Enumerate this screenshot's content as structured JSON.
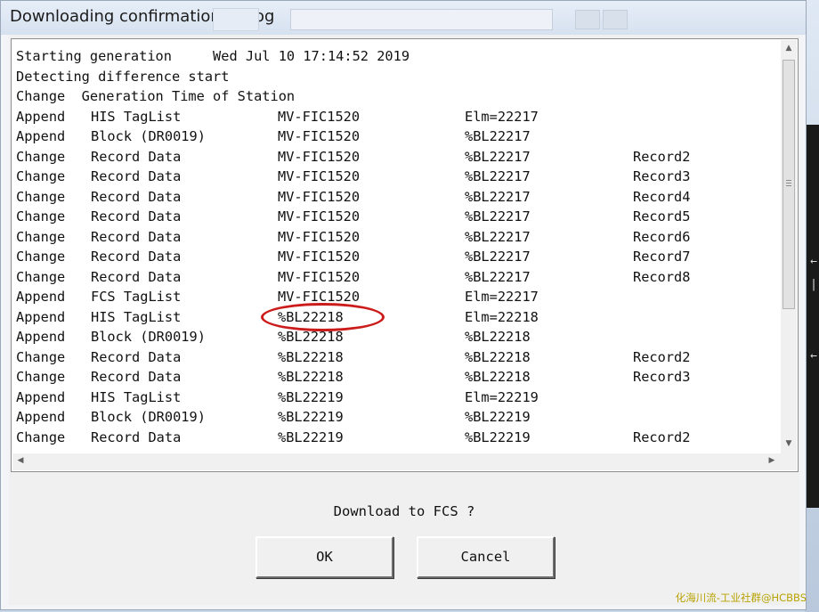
{
  "window": {
    "title": "Downloading confirmation dialog"
  },
  "log": {
    "lines": [
      {
        "c1": "Starting generation",
        "c2": "",
        "c3": "",
        "c4": "",
        "c5": "",
        "full": "Starting generation     Wed Jul 10 17:14:52 2019"
      },
      {
        "full": "Detecting difference start"
      },
      {
        "full": "Change  Generation Time of Station"
      },
      {
        "c1": "Append",
        "c2": "HIS TagList",
        "c3": "MV-FIC1520",
        "c4": "Elm=22217",
        "c5": ""
      },
      {
        "c1": "Append",
        "c2": "Block (DR0019)",
        "c3": "MV-FIC1520",
        "c4": "%BL22217",
        "c5": ""
      },
      {
        "c1": "Change",
        "c2": "Record Data",
        "c3": "MV-FIC1520",
        "c4": "%BL22217",
        "c5": "Record2"
      },
      {
        "c1": "Change",
        "c2": "Record Data",
        "c3": "MV-FIC1520",
        "c4": "%BL22217",
        "c5": "Record3"
      },
      {
        "c1": "Change",
        "c2": "Record Data",
        "c3": "MV-FIC1520",
        "c4": "%BL22217",
        "c5": "Record4"
      },
      {
        "c1": "Change",
        "c2": "Record Data",
        "c3": "MV-FIC1520",
        "c4": "%BL22217",
        "c5": "Record5"
      },
      {
        "c1": "Change",
        "c2": "Record Data",
        "c3": "MV-FIC1520",
        "c4": "%BL22217",
        "c5": "Record6"
      },
      {
        "c1": "Change",
        "c2": "Record Data",
        "c3": "MV-FIC1520",
        "c4": "%BL22217",
        "c5": "Record7"
      },
      {
        "c1": "Change",
        "c2": "Record Data",
        "c3": "MV-FIC1520",
        "c4": "%BL22217",
        "c5": "Record8"
      },
      {
        "c1": "Append",
        "c2": "FCS TagList",
        "c3": "MV-FIC1520",
        "c4": "Elm=22217",
        "c5": ""
      },
      {
        "c1": "Append",
        "c2": "HIS TagList",
        "c3": "%BL22218",
        "c4": "Elm=22218",
        "c5": ""
      },
      {
        "c1": "Append",
        "c2": "Block (DR0019)",
        "c3": "%BL22218",
        "c4": "%BL22218",
        "c5": ""
      },
      {
        "c1": "Change",
        "c2": "Record Data",
        "c3": "%BL22218",
        "c4": "%BL22218",
        "c5": "Record2"
      },
      {
        "c1": "Change",
        "c2": "Record Data",
        "c3": "%BL22218",
        "c4": "%BL22218",
        "c5": "Record3"
      },
      {
        "c1": "Append",
        "c2": "HIS TagList",
        "c3": "%BL22219",
        "c4": "Elm=22219",
        "c5": ""
      },
      {
        "c1": "Append",
        "c2": "Block (DR0019)",
        "c3": "%BL22219",
        "c4": "%BL22219",
        "c5": ""
      },
      {
        "c1": "Change",
        "c2": "Record Data",
        "c3": "%BL22219",
        "c4": "%BL22219",
        "c5": "Record2"
      }
    ]
  },
  "prompt": "Download to FCS ?",
  "buttons": {
    "ok": "OK",
    "cancel": "Cancel"
  },
  "watermark": "化海川流-工业社群@HCBBS",
  "colors": {
    "annotation": "#cc1b1b"
  }
}
